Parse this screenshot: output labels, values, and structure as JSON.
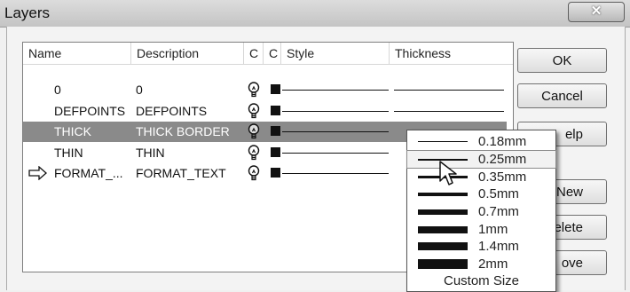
{
  "window": {
    "title": "Layers",
    "close_glyph": "✕"
  },
  "columns": [
    "Name",
    "Description",
    "C",
    "C",
    "Style",
    "Thickness"
  ],
  "rows": [
    {
      "name": "0",
      "description": "0",
      "current": false,
      "selected": false
    },
    {
      "name": "DEFPOINTS",
      "description": "DEFPOINTS",
      "current": false,
      "selected": false
    },
    {
      "name": "THICK",
      "description": "THICK BORDER",
      "current": false,
      "selected": true
    },
    {
      "name": "THIN",
      "description": "THIN",
      "current": false,
      "selected": false
    },
    {
      "name": "FORMAT_...",
      "description": "FORMAT_TEXT",
      "current": true,
      "selected": false
    }
  ],
  "buttons": {
    "ok": "OK",
    "cancel": "Cancel",
    "help": "elp",
    "new": "New",
    "delete": "elete",
    "remove": "ove"
  },
  "thickness_menu": {
    "options": [
      "0.18mm",
      "0.25mm",
      "0.35mm",
      "0.5mm",
      "0.7mm",
      "1mm",
      "1.4mm",
      "2mm"
    ],
    "custom": "Custom Size",
    "highlighted": "0.25mm"
  },
  "colors": {
    "selected_row": "#8a8a8a",
    "line": "#111111"
  },
  "icons": [
    "bulb-icon",
    "color-swatch-icon",
    "current-layer-arrow-icon",
    "mouse-pointer-icon"
  ]
}
